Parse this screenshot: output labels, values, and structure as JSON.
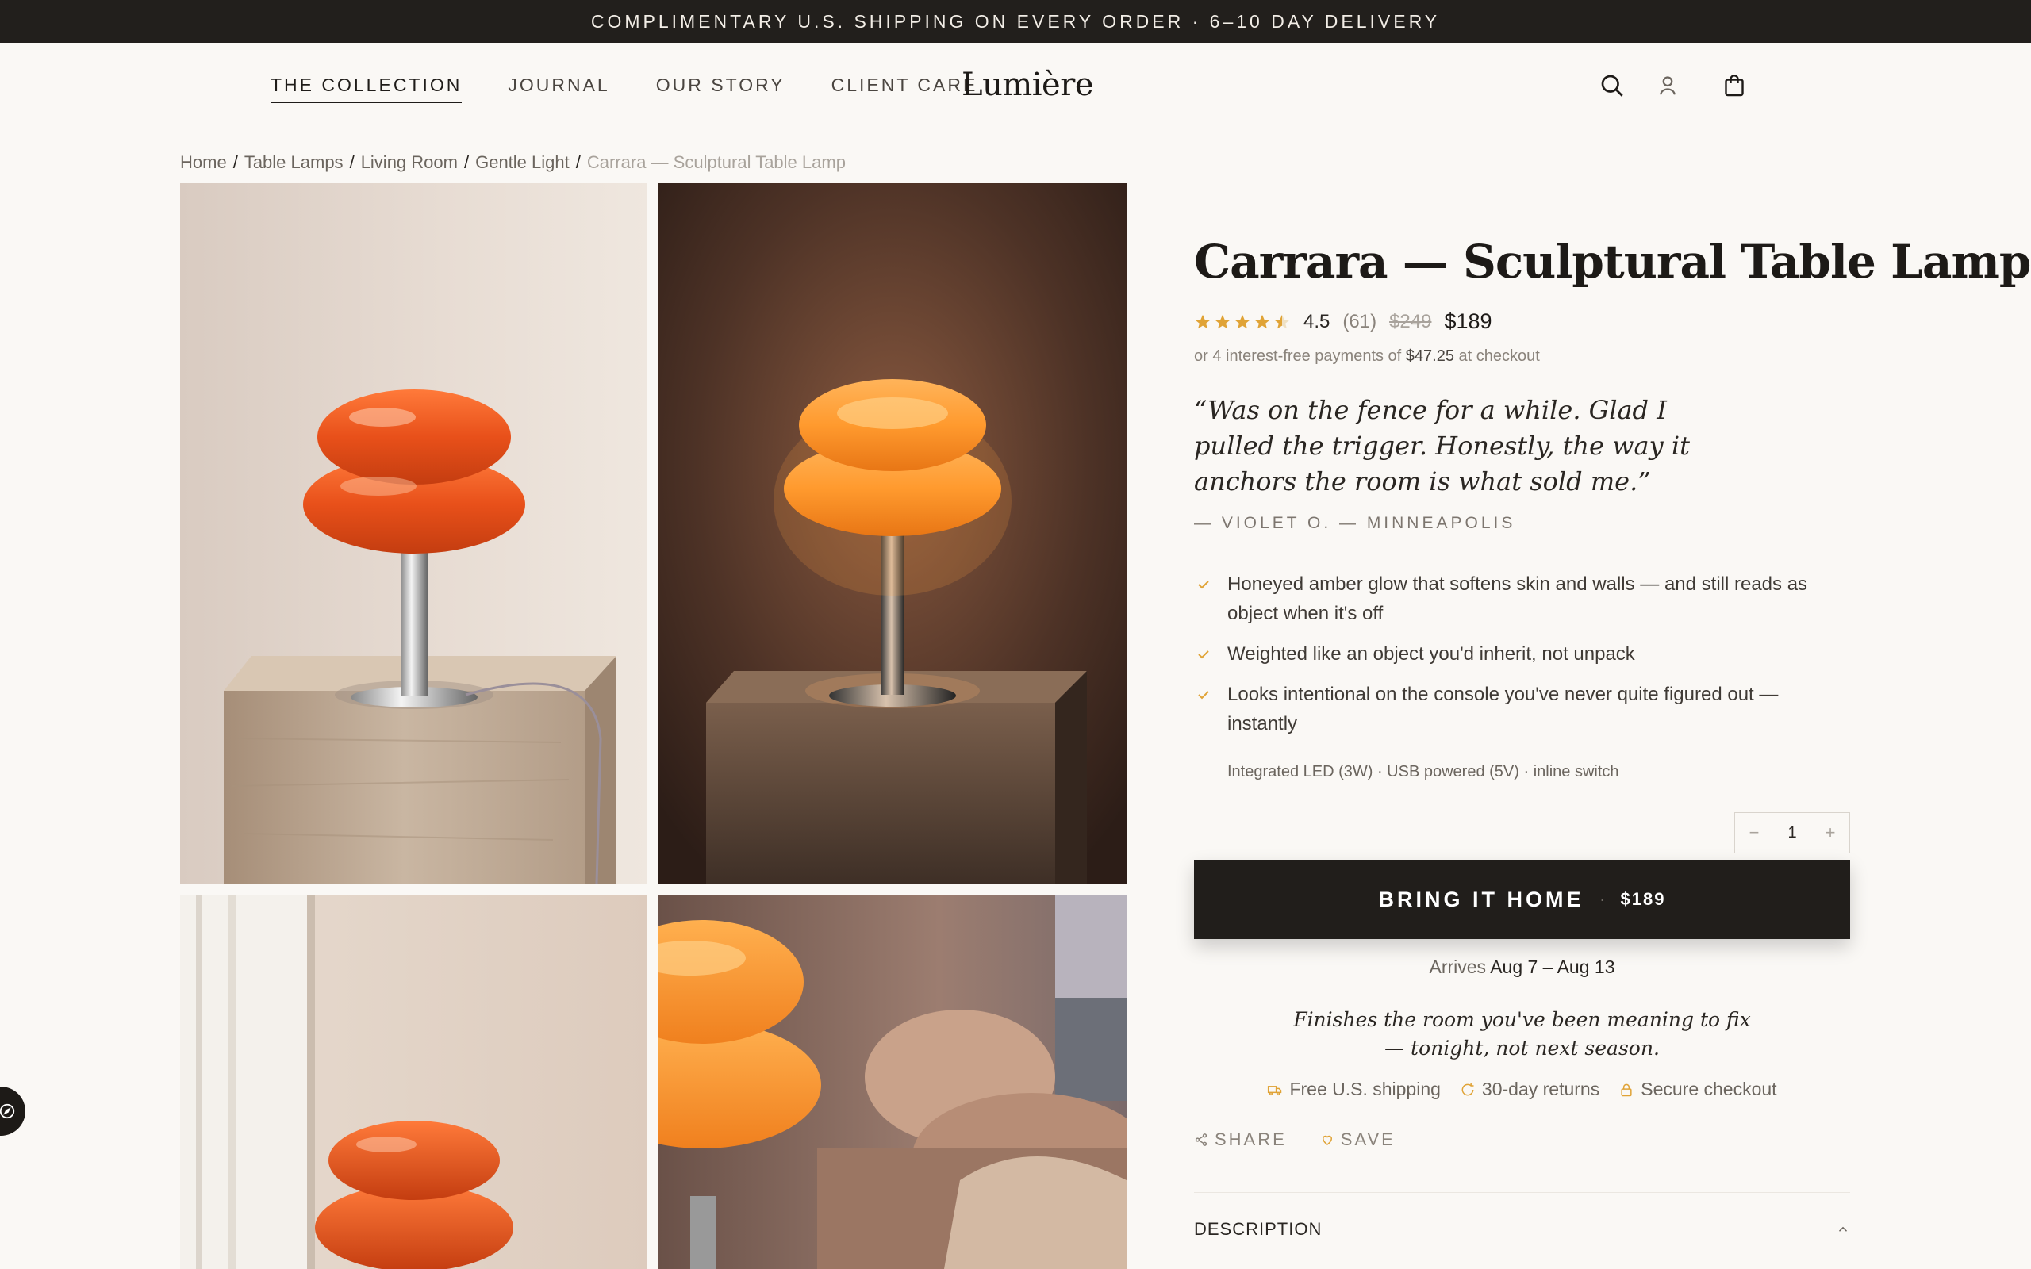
{
  "announcement": "COMPLIMENTARY U.S. SHIPPING ON EVERY ORDER · 6–10 DAY DELIVERY",
  "nav": {
    "items": [
      {
        "label": "THE COLLECTION",
        "active": true
      },
      {
        "label": "JOURNAL"
      },
      {
        "label": "OUR STORY"
      },
      {
        "label": "CLIENT CARE"
      }
    ],
    "logo": "Lumière",
    "icons": [
      "search-icon",
      "account-icon",
      "cart-icon"
    ]
  },
  "breadcrumb": [
    "Home",
    "Table Lamps",
    "Living Room",
    "Gentle Light",
    "Carrara — Sculptural Table Lamp"
  ],
  "product": {
    "title": "Carrara — Sculptural Table Lamp",
    "rating": "4.5",
    "review_count": "(61)",
    "rating_value": 4.5,
    "price_old": "$249",
    "price": "$189",
    "installments_pre": "or 4 interest-free payments of ",
    "installments_amount": "$47.25",
    "installments_post": " at checkout",
    "quote": "“Was on the fence for a while. Glad I pulled the trigger. Honestly, the way it anchors the room is what sold me.”",
    "quote_author": "— VIOLET O. — MINNEAPOLIS",
    "benefits": [
      "Honeyed amber glow that softens skin and walls — and still reads as object when it's off",
      "Weighted like an object you'd inherit, not unpack",
      "Looks intentional on the console you've never quite figured out — instantly"
    ],
    "specs": "Integrated LED (3W) · USB powered (5V) · inline switch",
    "quantity": "1",
    "qty_minus": "−",
    "qty_plus": "+",
    "cta_label": "BRING IT HOME",
    "cta_dot": "·",
    "cta_price": "$189",
    "arrives_label": "Arrives ",
    "arrives_dates": "Aug 7 – Aug 13",
    "tagline_line1": "Finishes the room you've been meaning to fix",
    "tagline_line2": "— tonight, not next season.",
    "trust": [
      "Free U.S. shipping",
      "30-day returns",
      "Secure checkout"
    ],
    "share": "SHARE",
    "save": "SAVE",
    "description": "DESCRIPTION"
  },
  "colors": {
    "accent": "#e0a336",
    "dark": "#211e1b",
    "background": "#faf8f5",
    "lamp_orange": "#ef5a1c"
  }
}
